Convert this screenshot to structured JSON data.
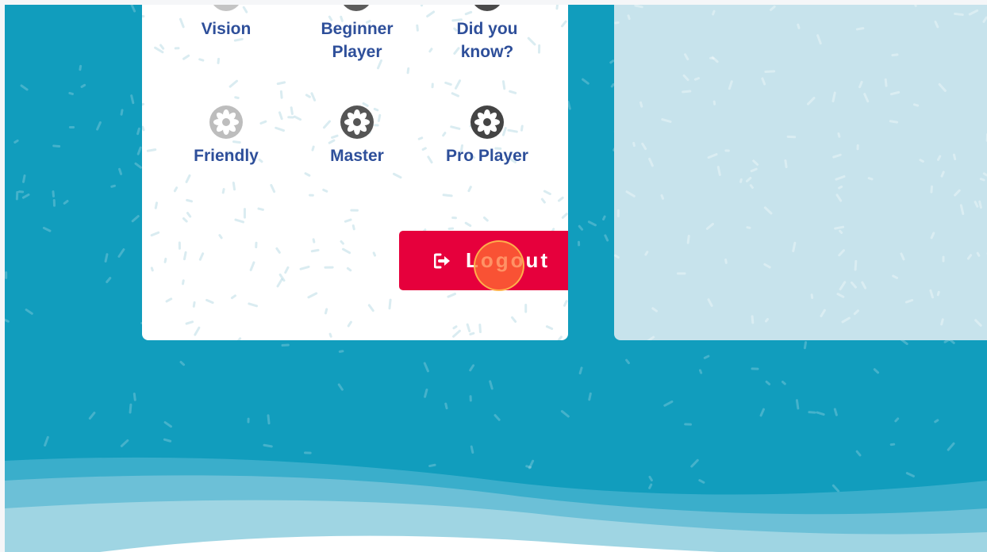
{
  "badges": {
    "row1": [
      {
        "label_line1": "Vision",
        "label_line2": "",
        "icon": "badge-flower-icon",
        "color": "#c4c4c4"
      },
      {
        "label_line1": "Beginner",
        "label_line2": "Player",
        "icon": "badge-flower-icon",
        "color": "#5c5c5c"
      },
      {
        "label_line1": "Did you",
        "label_line2": "know?",
        "icon": "badge-flower-icon",
        "color": "#4a4a4a"
      }
    ],
    "row2": [
      {
        "label": "Friendly",
        "icon": "badge-flower-icon",
        "color": "#bdbdbd"
      },
      {
        "label": "Master",
        "icon": "badge-flower-icon",
        "color": "#555555"
      },
      {
        "label": "Pro Player",
        "icon": "badge-flower-icon",
        "color": "#444444"
      }
    ]
  },
  "logout": {
    "label": "Logout",
    "icon": "logout-icon",
    "color": "#e6003c"
  },
  "colors": {
    "background": "#119dbd",
    "panel": "#c7e3ec",
    "badge_text": "#2e4f9a"
  }
}
